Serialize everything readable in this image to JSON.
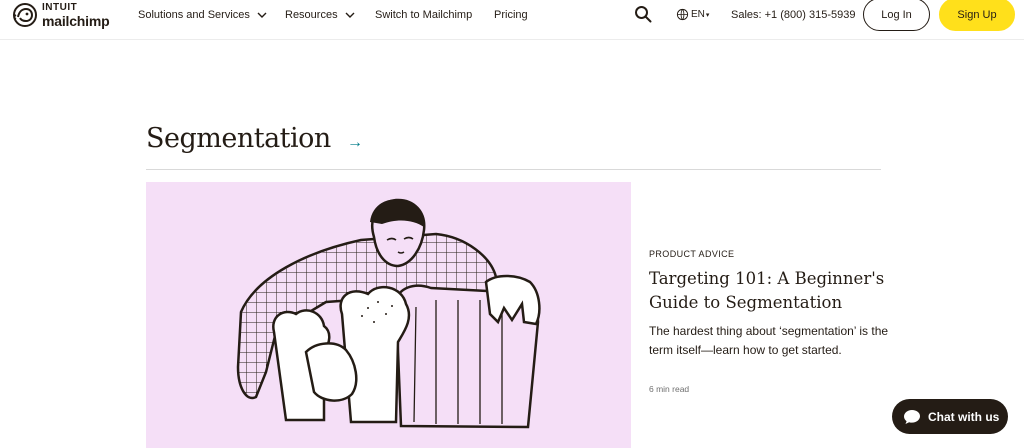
{
  "header": {
    "logo": {
      "intuit": "INTUIT",
      "name": "mailchimp"
    },
    "nav": [
      {
        "label": "Solutions and Services",
        "has_dropdown": true
      },
      {
        "label": "Resources",
        "has_dropdown": true
      },
      {
        "label": "Switch to Mailchimp",
        "has_dropdown": false
      },
      {
        "label": "Pricing",
        "has_dropdown": false
      }
    ],
    "search_icon": "search-icon",
    "language": "EN",
    "sales": "Sales: +1 (800) 315-5939",
    "login_label": "Log In",
    "signup_label": "Sign Up"
  },
  "section": {
    "title": "Segmentation",
    "arrow": "→"
  },
  "article": {
    "category": "PRODUCT ADVICE",
    "title": "Targeting 101: A Beginner's Guide to Segmentation",
    "description": "The hardest thing about ‘segmentation’ is the term itself—learn how to get started.",
    "read_time": "6 min read"
  },
  "chat": {
    "label": "Chat with us"
  },
  "colors": {
    "accent_yellow": "#ffe01b",
    "ink": "#241c15",
    "teal": "#007c89",
    "image_bg": "#f5dff7"
  }
}
